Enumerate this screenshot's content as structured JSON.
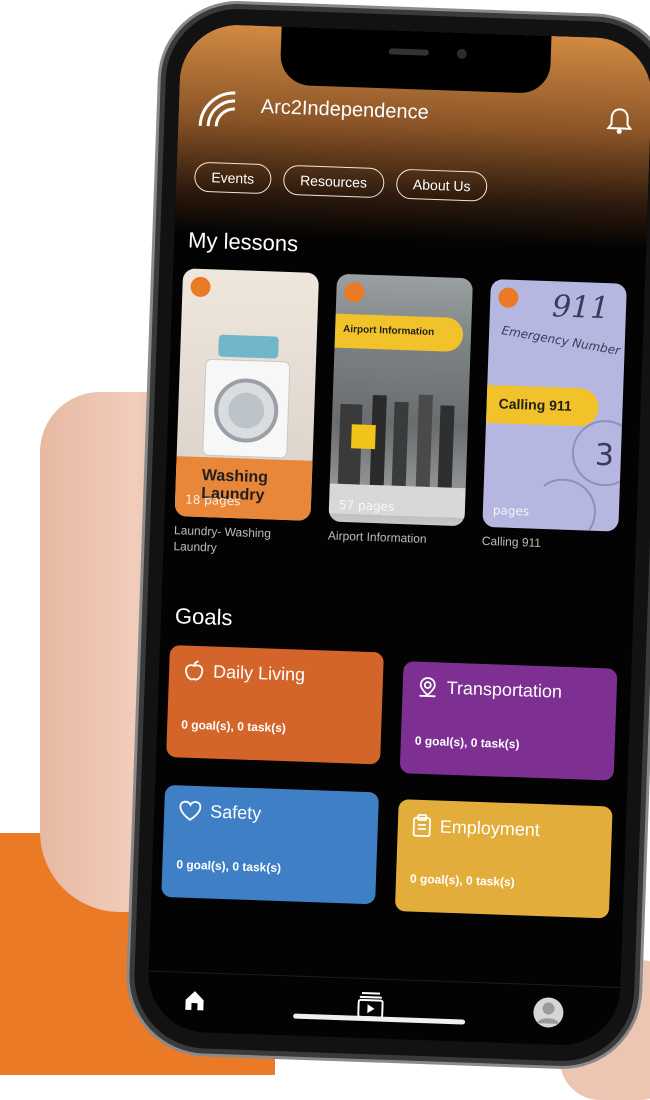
{
  "app": {
    "title": "Arc2Independence"
  },
  "nav": {
    "events": "Events",
    "resources": "Resources",
    "about": "About Us"
  },
  "lessons": {
    "heading": "My lessons",
    "items": [
      {
        "tag": "Washing Laundry",
        "pages": "18 pages",
        "label": "Laundry- Washing Laundry"
      },
      {
        "tag": "Airport Information",
        "pages": "57 pages",
        "label": "Airport Information"
      },
      {
        "tag": "Calling 911",
        "pages": "pages",
        "label": "Calling 911",
        "overlay": "911",
        "overlay_sub": "Emergency Number"
      }
    ]
  },
  "goals": {
    "heading": "Goals",
    "items": [
      {
        "title": "Daily Living",
        "summary": "0 goal(s), 0 task(s)",
        "color": "#d4652a",
        "icon": "apple-icon"
      },
      {
        "title": "Transportation",
        "summary": "0 goal(s), 0 task(s)",
        "color": "#7d2f92",
        "icon": "map-pin-icon"
      },
      {
        "title": "Safety",
        "summary": "0 goal(s), 0 task(s)",
        "color": "#3e7fc5",
        "icon": "heart-hand-icon"
      },
      {
        "title": "Employment",
        "summary": "0 goal(s), 0 task(s)",
        "color": "#e3ad3c",
        "icon": "clipboard-icon"
      }
    ]
  },
  "tabbar": {
    "home": "home-icon",
    "library": "library-icon",
    "profile": "avatar"
  },
  "colors": {
    "accent": "#ea7a25"
  }
}
